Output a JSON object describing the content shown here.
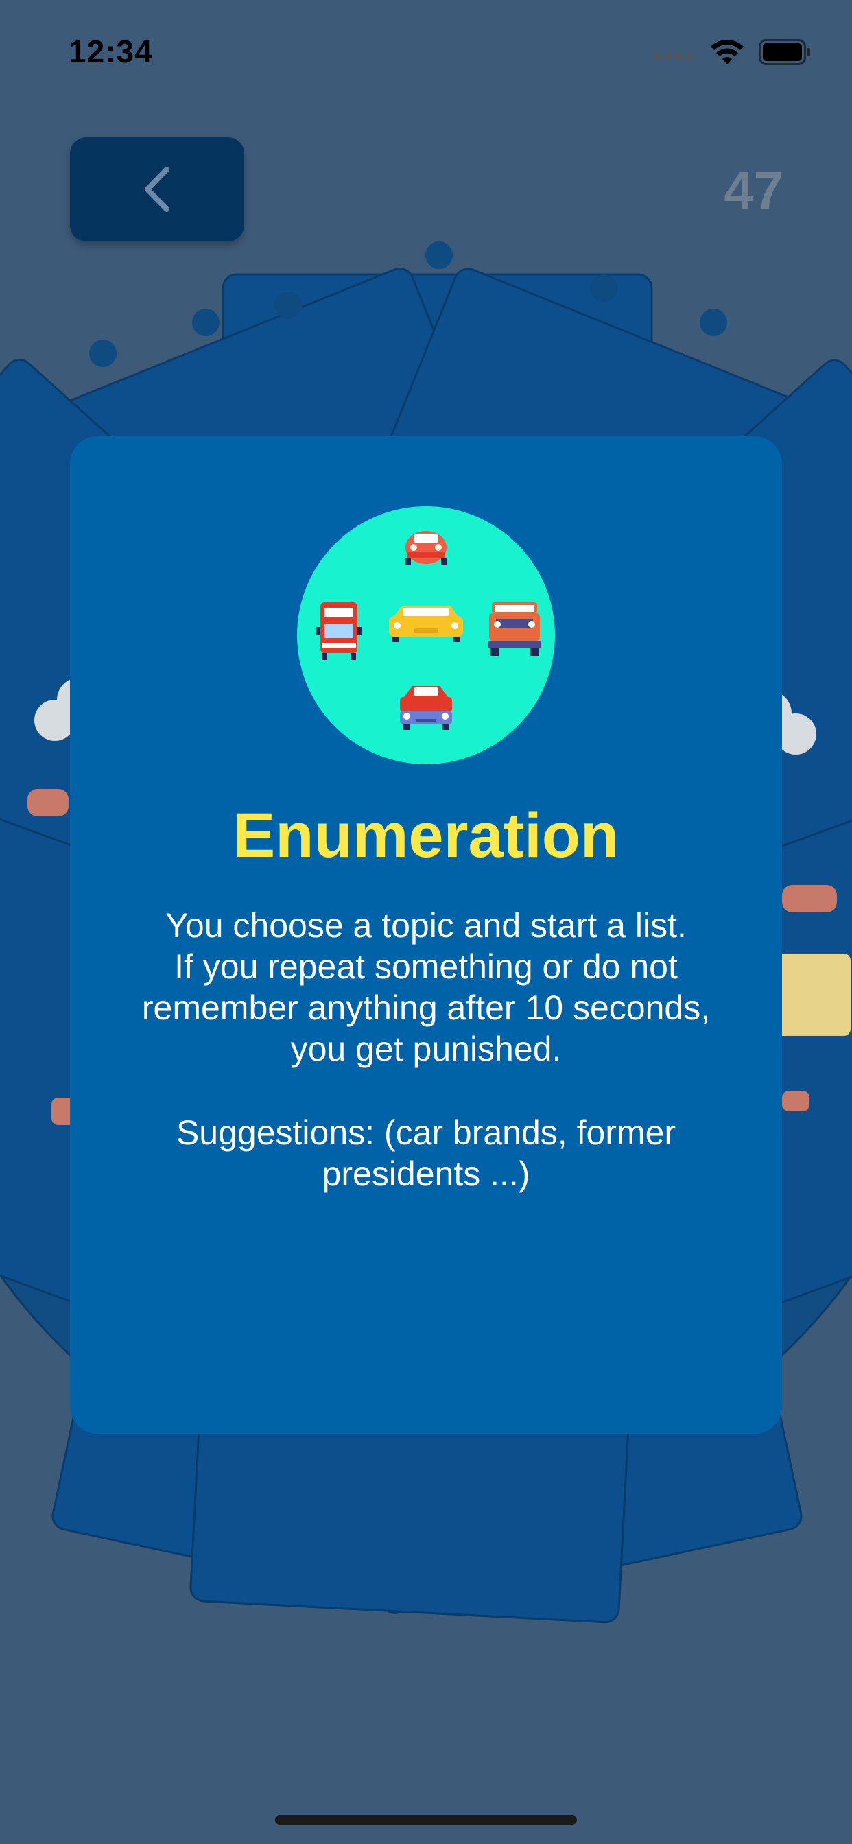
{
  "status_bar": {
    "time": "12:34"
  },
  "header": {
    "counter": "47"
  },
  "card": {
    "title": "Enumeration",
    "description": "You choose a topic and start a list.\nIf you repeat something or do not remember anything after 10 seconds, you get punished.",
    "suggestions": "Suggestions: (car brands, former presidents ...)"
  },
  "icons": {
    "back": "chevron-left-icon",
    "illustration": "vehicles-illustration",
    "wifi": "wifi-icon",
    "battery": "battery-icon",
    "signal": "cellular-signal-icon"
  },
  "colors": {
    "background": "#3d5a78",
    "card": "#0063a8",
    "title": "#fbe84a",
    "icon_circle": "#19f2cf",
    "back_button": "#04345e",
    "counter": "#6e7f91"
  }
}
